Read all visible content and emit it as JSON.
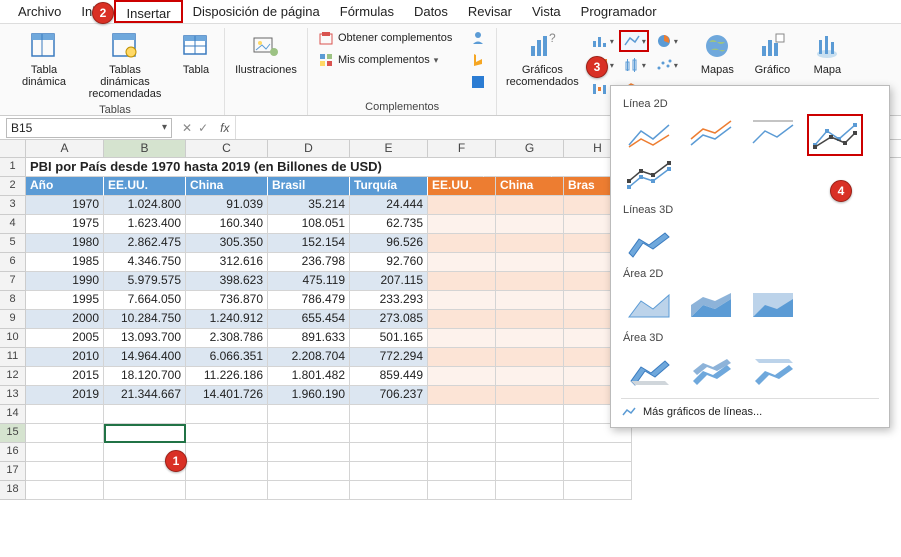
{
  "menubar": [
    "Archivo",
    "Inici",
    "Insertar",
    "Disposición de página",
    "Fórmulas",
    "Datos",
    "Revisar",
    "Vista",
    "Programador"
  ],
  "active_menu_index": 2,
  "ribbon": {
    "tablas": {
      "label": "Tablas",
      "pivot": "Tabla\ndinámica",
      "recpivot": "Tablas dinámicas\nrecomendadas",
      "table": "Tabla"
    },
    "ilustr": {
      "btn": "Ilustraciones"
    },
    "compl": {
      "label": "Complementos",
      "get": "Obtener complementos",
      "my": "Mis complementos"
    },
    "graficos": {
      "rec": "Gráficos\nrecomendados",
      "maps": "Mapas",
      "pivotchart": "Gráfico",
      "map3d": "Mapa"
    }
  },
  "namebox": "B15",
  "title_row": "PBI por País desde 1970 hasta 2019 (en Billones de USD)",
  "headers": [
    "Año",
    "EE.UU.",
    "China",
    "Brasil",
    "Turquía",
    "EE.UU.",
    "China",
    "Bras"
  ],
  "data_rows": [
    {
      "year": "1970",
      "us": "1.024.800",
      "cn": "91.039",
      "br": "35.214",
      "tr": "24.444"
    },
    {
      "year": "1975",
      "us": "1.623.400",
      "cn": "160.340",
      "br": "108.051",
      "tr": "62.735"
    },
    {
      "year": "1980",
      "us": "2.862.475",
      "cn": "305.350",
      "br": "152.154",
      "tr": "96.526"
    },
    {
      "year": "1985",
      "us": "4.346.750",
      "cn": "312.616",
      "br": "236.798",
      "tr": "92.760"
    },
    {
      "year": "1990",
      "us": "5.979.575",
      "cn": "398.623",
      "br": "475.119",
      "tr": "207.115"
    },
    {
      "year": "1995",
      "us": "7.664.050",
      "cn": "736.870",
      "br": "786.479",
      "tr": "233.293"
    },
    {
      "year": "2000",
      "us": "10.284.750",
      "cn": "1.240.912",
      "br": "655.454",
      "tr": "273.085"
    },
    {
      "year": "2005",
      "us": "13.093.700",
      "cn": "2.308.786",
      "br": "891.633",
      "tr": "501.165"
    },
    {
      "year": "2010",
      "us": "14.964.400",
      "cn": "6.066.351",
      "br": "2.208.704",
      "tr": "772.294"
    },
    {
      "year": "2015",
      "us": "18.120.700",
      "cn": "11.226.186",
      "br": "1.801.482",
      "tr": "859.449"
    },
    {
      "year": "2019",
      "us": "21.344.667",
      "cn": "14.401.726",
      "br": "1.960.190",
      "tr": "706.237"
    }
  ],
  "columns": [
    "A",
    "B",
    "C",
    "D",
    "E",
    "F",
    "G",
    "H"
  ],
  "dropdown": {
    "s1": "Línea 2D",
    "s2": "Líneas 3D",
    "s3": "Área 2D",
    "s4": "Área 3D",
    "more": "Más gráficos de líneas..."
  },
  "callouts": {
    "c1": "1",
    "c2": "2",
    "c3": "3",
    "c4": "4"
  },
  "chart_data": {
    "type": "table",
    "title": "PBI por País desde 1970 hasta 2019 (en Billones de USD)",
    "categories": [
      1970,
      1975,
      1980,
      1985,
      1990,
      1995,
      2000,
      2005,
      2010,
      2015,
      2019
    ],
    "series": [
      {
        "name": "EE.UU.",
        "values": [
          1024800,
          1623400,
          2862475,
          4346750,
          5979575,
          7664050,
          10284750,
          13093700,
          14964400,
          18120700,
          21344667
        ]
      },
      {
        "name": "China",
        "values": [
          91039,
          160340,
          305350,
          312616,
          398623,
          736870,
          1240912,
          2308786,
          6066351,
          11226186,
          14401726
        ]
      },
      {
        "name": "Brasil",
        "values": [
          35214,
          108051,
          152154,
          236798,
          475119,
          786479,
          655454,
          891633,
          2208704,
          1801482,
          1960190
        ]
      },
      {
        "name": "Turquía",
        "values": [
          24444,
          62735,
          96526,
          92760,
          207115,
          233293,
          273085,
          501165,
          772294,
          859449,
          706237
        ]
      }
    ]
  }
}
